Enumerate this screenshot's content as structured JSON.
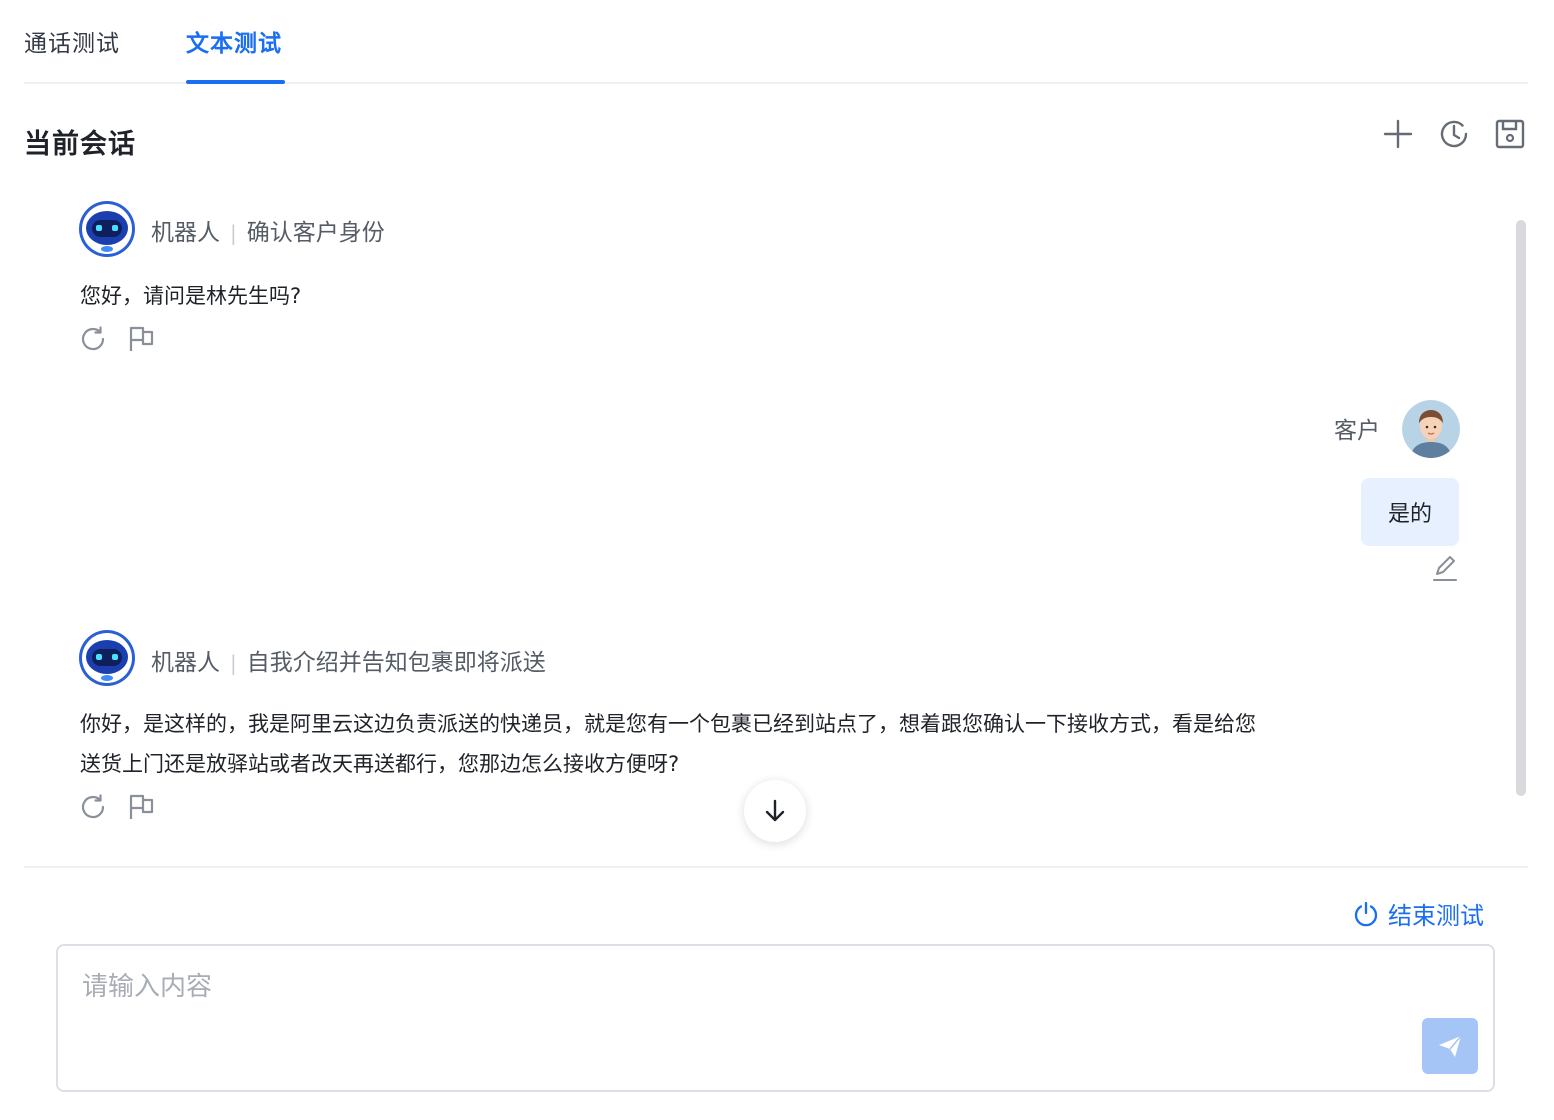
{
  "tabs": [
    {
      "label": "通话测试",
      "active": false
    },
    {
      "label": "文本测试",
      "active": true
    }
  ],
  "session": {
    "title": "当前会话",
    "icons": [
      "plus-icon",
      "history-icon",
      "save-icon"
    ]
  },
  "messages": [
    {
      "role": "bot",
      "sender": "机器人",
      "intent": "确认客户身份",
      "text": "您好，请问是林先生吗?"
    },
    {
      "role": "customer",
      "sender": "客户",
      "text": "是的"
    },
    {
      "role": "bot",
      "sender": "机器人",
      "intent": "自我介绍并告知包裹即将派送",
      "text_line1": "你好，是这样的，我是阿里云这边负责派送的快递员，就是您有一个包裹已经到站点了，想着跟您确认一下接收方式，看是给您",
      "text_line2": "送货上门还是放驿站或者改天再送都行，您那边怎么接收方便呀?"
    }
  ],
  "footer": {
    "end_test_label": "结束测试",
    "input_placeholder": "请输入内容",
    "input_value": ""
  },
  "colors": {
    "accent": "#1a6ef2",
    "bubble_customer": "#e7f0fe",
    "send_disabled": "#a5c5f6"
  }
}
